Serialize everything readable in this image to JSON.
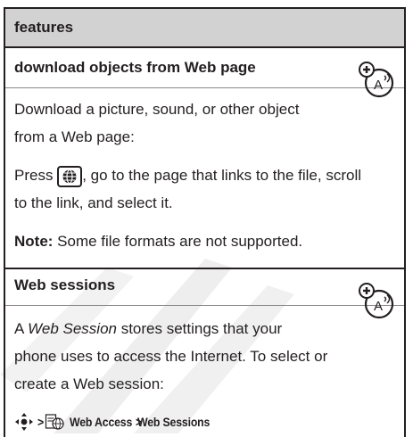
{
  "header": {
    "title": "features"
  },
  "section1": {
    "title": "download objects from Web page",
    "intro_line1": "Download a picture, sound, or other object",
    "intro_line2": "from a Web page:",
    "press_before": "Press",
    "press_after": ", go to the page that links to the file, scroll",
    "press_line2": "to the link, and select it.",
    "note_label": "Note:",
    "note_text": " Some file formats are not supported."
  },
  "section2": {
    "title": "Web sessions",
    "line1_a": "A ",
    "line1_italic": "Web Session",
    "line1_b": " stores settings that your",
    "line2": "phone uses to access the Internet. To select or",
    "line3": "create a Web session:",
    "path_sep1": " > ",
    "path_item1": "Web Access",
    "path_sep2": " > ",
    "path_item2": "Web Sessions"
  },
  "icons": {
    "carrier_icon": "carrier-dependent-feature-icon",
    "browser_key": "web-browser-key-icon",
    "nav_key": "navigation-key-icon",
    "web_access": "web-access-menu-icon"
  },
  "colors": {
    "header_bg": "#d3d2d2",
    "text": "#231f20",
    "watermark": "#e6e6e6"
  }
}
